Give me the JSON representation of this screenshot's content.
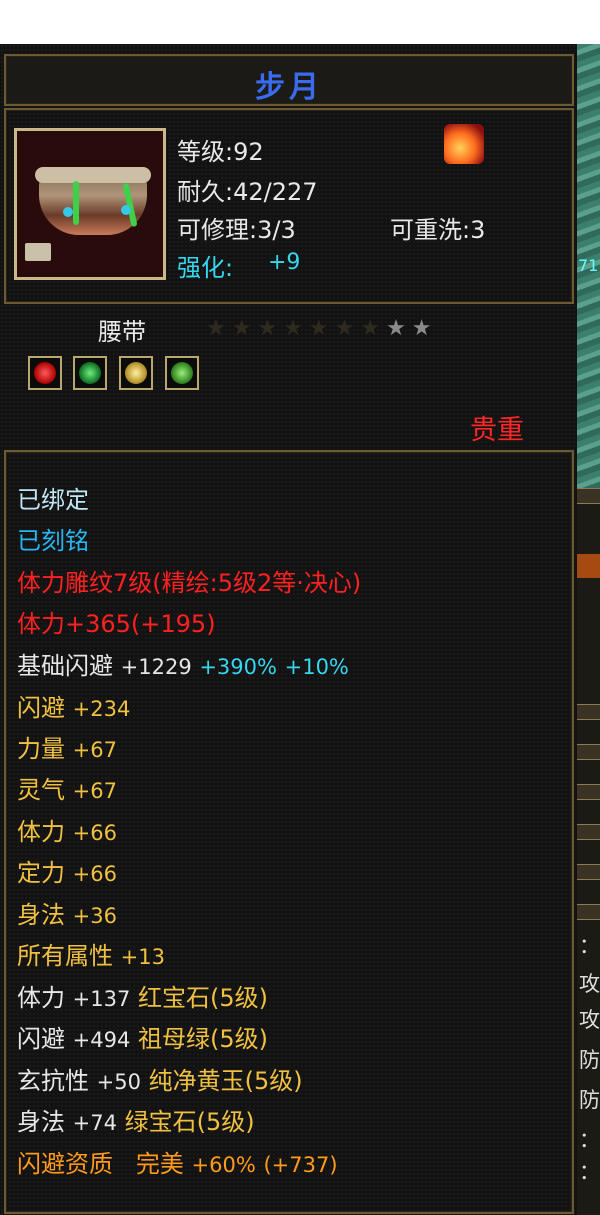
{
  "item": {
    "name": "步月",
    "level": "等级:92",
    "durability": "耐久:42/227",
    "repair": "可修理:3/3",
    "rewash": "可重洗:3",
    "enhance_label": "强化:",
    "enhance_value": "+9",
    "type": "腰带",
    "rarity": "贵重",
    "stars": {
      "total": 9,
      "lit": 2
    }
  },
  "gems": [
    {
      "name": "red-gem",
      "color": "#e02020"
    },
    {
      "name": "emerald-gem",
      "color": "#1fa03a"
    },
    {
      "name": "yellow-jade-gem",
      "color": "#e8c448"
    },
    {
      "name": "green-gem",
      "color": "#3fc040"
    }
  ],
  "status": {
    "bound": "已绑定",
    "engraved": "已刻铭"
  },
  "attributes": {
    "carving": "体力雕纹7级(精绘:5级2等·决心)",
    "stamina_carving": "体力+365(+195)",
    "base_dodge_label": "基础闪避",
    "base_dodge_value": "+1229",
    "base_dodge_pct1": "+390%",
    "base_dodge_pct2": "+10%",
    "stats": [
      {
        "label": "闪避",
        "value": "+234"
      },
      {
        "label": "力量",
        "value": "+67"
      },
      {
        "label": "灵气",
        "value": "+67"
      },
      {
        "label": "体力",
        "value": "+66"
      },
      {
        "label": "定力",
        "value": "+66"
      },
      {
        "label": "身法",
        "value": "+36"
      },
      {
        "label": "所有属性",
        "value": "+13"
      }
    ],
    "gem_stats": [
      {
        "label": "体力",
        "value": "+137",
        "gem": "红宝石(5级)"
      },
      {
        "label": "闪避",
        "value": "+494",
        "gem": "祖母绿(5级)"
      },
      {
        "label": "玄抗性",
        "value": "+50",
        "gem": "纯净黄玉(5级)"
      },
      {
        "label": "身法",
        "value": "+74",
        "gem": "绿宝石(5级)"
      }
    ],
    "aptitude": {
      "label": "闪避资质",
      "grade": "完美",
      "pct": "+60%",
      "bonus": "(+737)"
    }
  },
  "side_panel": {
    "map_text": "71",
    "chars": [
      "：",
      "：",
      "攻",
      "攻",
      "防",
      "防",
      "：",
      "："
    ]
  },
  "colors": {
    "title": "#3a6cf0",
    "rarity": "#ff2626",
    "carving": "#ff2020",
    "stat": "#f0c040",
    "aptitude": "#ff9a1a",
    "cyan": "#35d6f0",
    "frame": "#6e5a32"
  }
}
